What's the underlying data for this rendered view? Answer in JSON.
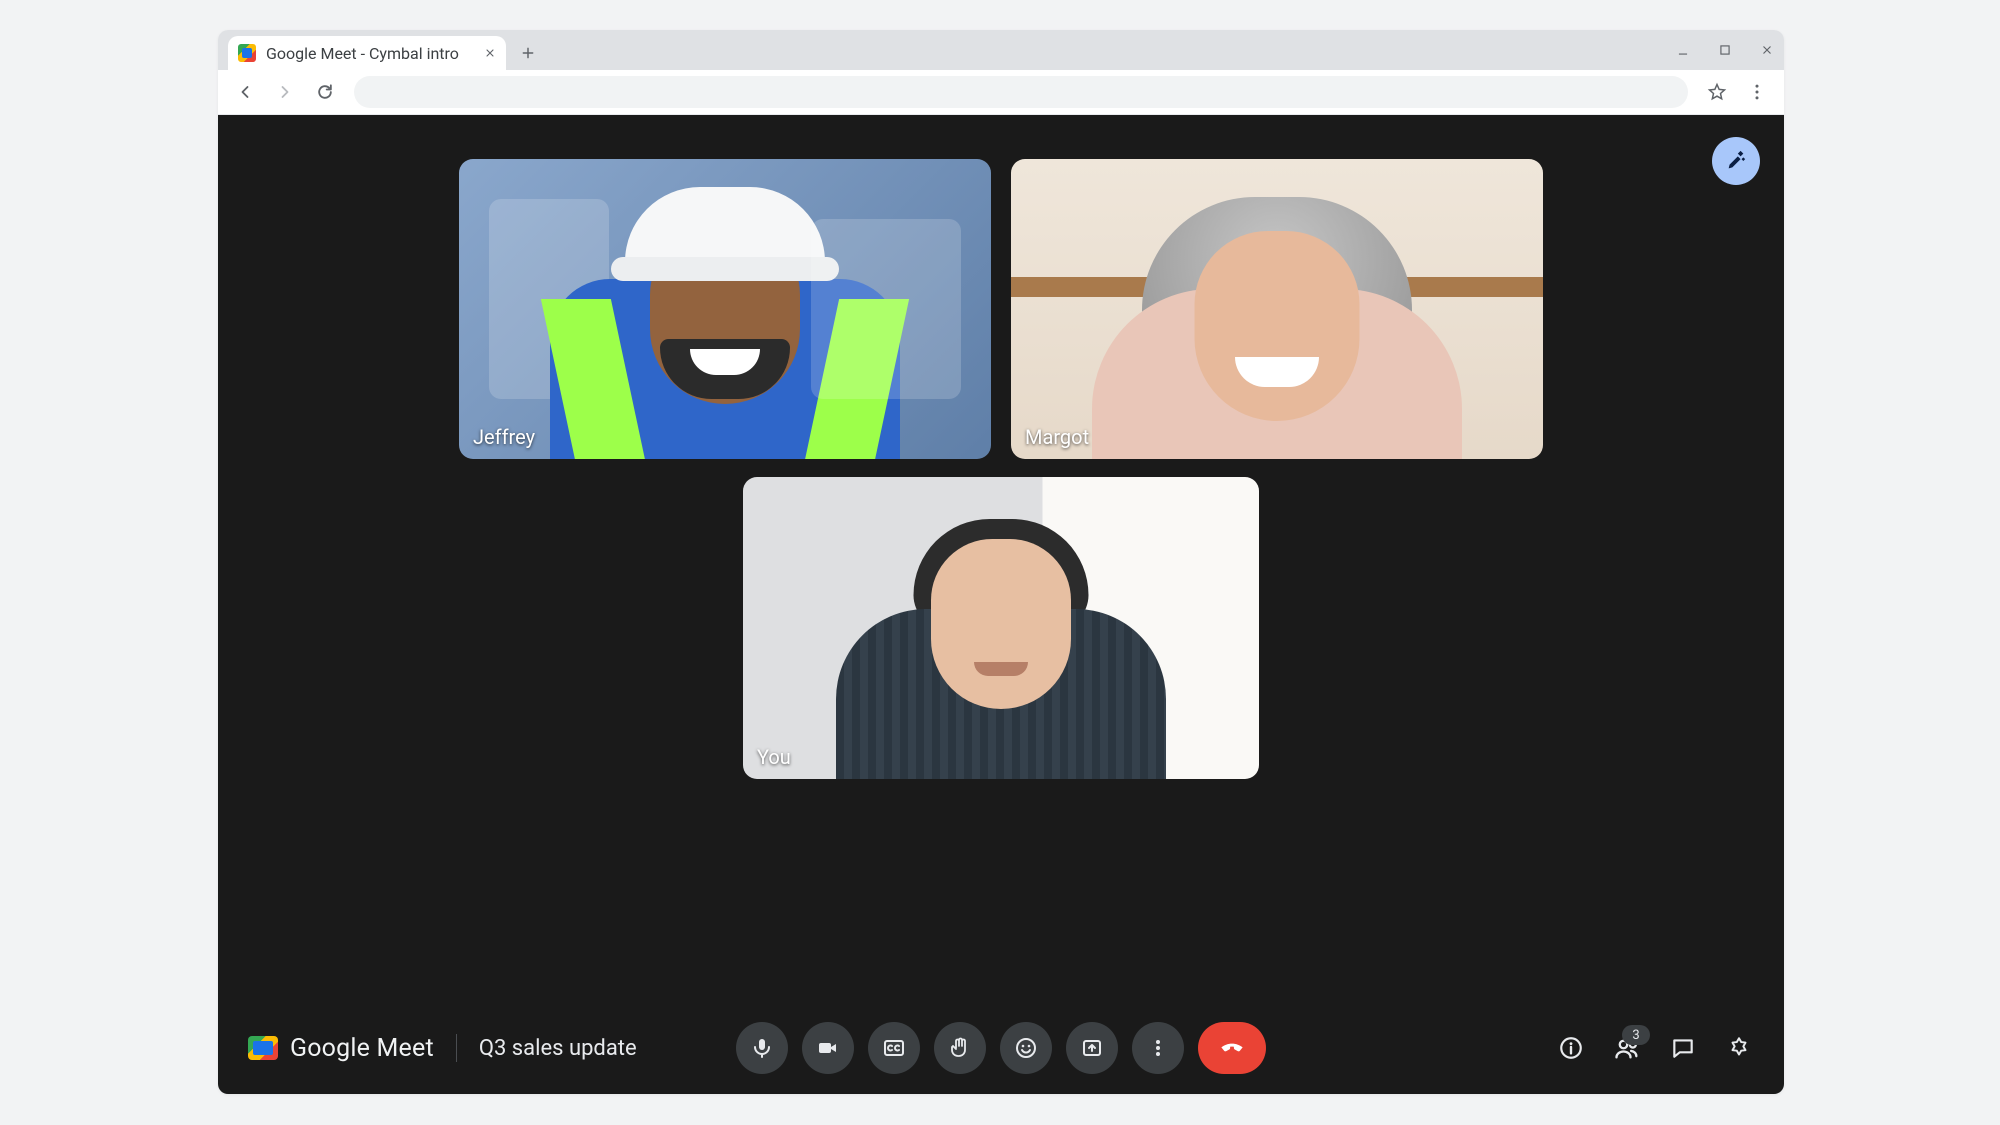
{
  "browser": {
    "tab_title": "Google Meet - Cymbal intro"
  },
  "meet": {
    "brand": "Google Meet",
    "meeting_title": "Q3 sales update",
    "participants_badge": "3",
    "tiles": [
      {
        "name": "Jeffrey"
      },
      {
        "name": "Margot"
      },
      {
        "name": "You"
      }
    ]
  }
}
